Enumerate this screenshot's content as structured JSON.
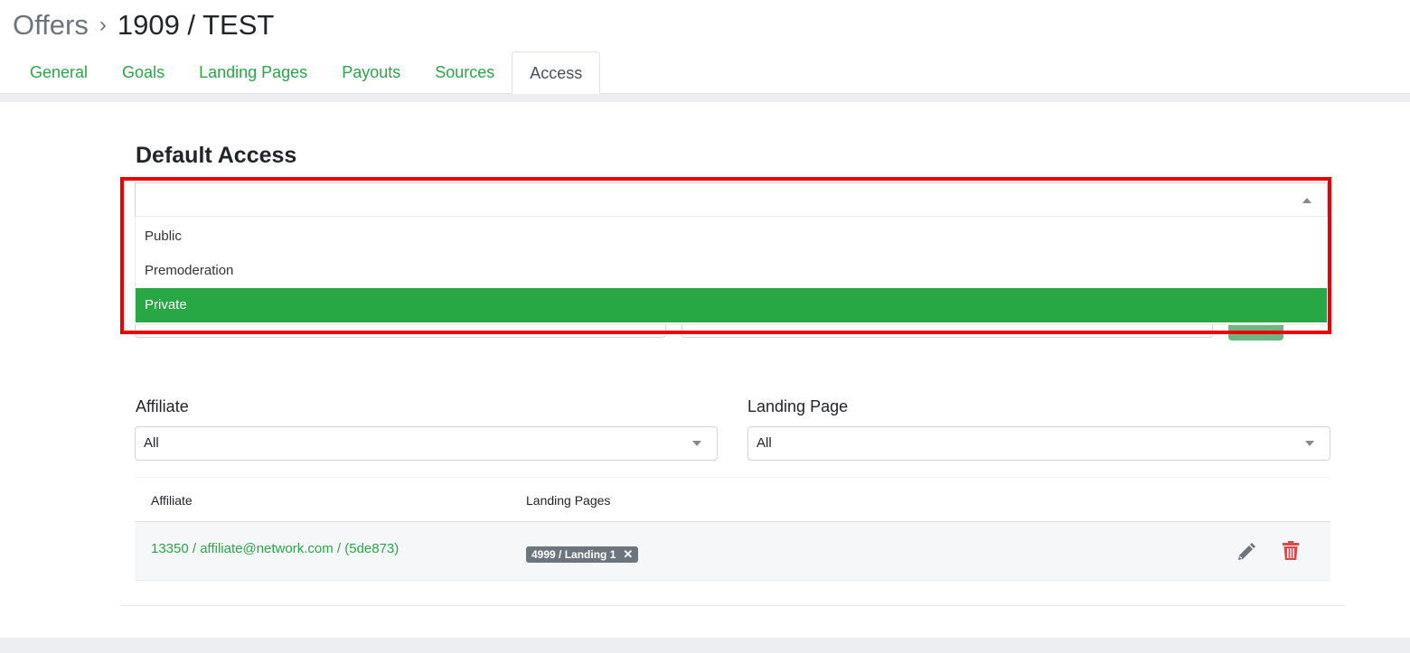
{
  "breadcrumb": {
    "parent": "Offers",
    "separator": "›",
    "current": "1909 / TEST"
  },
  "tabs": [
    "General",
    "Goals",
    "Landing Pages",
    "Payouts",
    "Sources",
    "Access"
  ],
  "active_tab": "Access",
  "default_access": {
    "title": "Default Access",
    "value": "",
    "options": [
      "Public",
      "Premoderation",
      "Private"
    ],
    "selected_option": "Private"
  },
  "filters": {
    "affiliate_label": "Affiliate",
    "affiliate_value": "All",
    "landing_label": "Landing Page",
    "landing_value": "All"
  },
  "table": {
    "headers": [
      "Affiliate",
      "Landing Pages"
    ],
    "rows": [
      {
        "affiliate": "13350 / affiliate@network.com / (5de873)",
        "landing_badge": "4999 / Landing 1",
        "badge_remove": "✕"
      }
    ]
  },
  "colors": {
    "accent": "#28a745",
    "highlight_border": "#ee0000",
    "delete": "#e04848"
  },
  "icons": [
    "chevron-right-icon",
    "caret-up-icon",
    "caret-down-icon",
    "close-icon",
    "pencil-icon",
    "trash-icon"
  ]
}
